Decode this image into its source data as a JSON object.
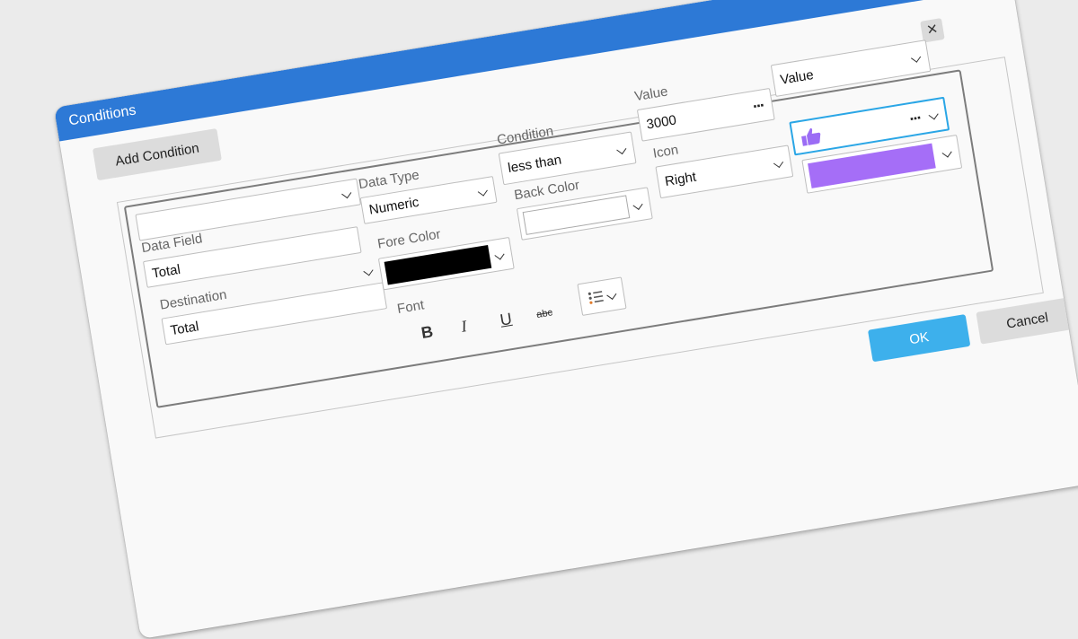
{
  "window": {
    "title": "Conditions"
  },
  "toolbar": {
    "add_condition_label": "Add Condition"
  },
  "condition": {
    "data_field": {
      "label": "Data Field",
      "value": "Total"
    },
    "destination": {
      "label": "Destination",
      "value": "Total"
    },
    "data_type": {
      "label": "Data Type",
      "value": "Numeric"
    },
    "fore_color": {
      "label": "Fore Color",
      "color": "#000000"
    },
    "font": {
      "label": "Font",
      "bold": "B",
      "italic": "I",
      "underline": "U",
      "strikethrough": "abc"
    },
    "condition_op": {
      "label": "Condition",
      "value": "less than"
    },
    "back_color": {
      "label": "Back Color",
      "color": "#ffffff"
    },
    "value": {
      "label": "Value",
      "value": "3000",
      "browse": "..."
    },
    "icon": {
      "label": "Icon",
      "value": "Right"
    },
    "value_type": {
      "value": "Value"
    },
    "icon_picker": {
      "icon": "thumbs-up-icon",
      "color": "#9b6cf5",
      "browse": "..."
    },
    "color_picker": {
      "color": "#a56ef7"
    },
    "list_style": {
      "icon": "list-format-icon"
    }
  },
  "footer": {
    "ok_label": "OK",
    "cancel_label": "Cancel"
  },
  "colors": {
    "titlebar": "#2d79d6",
    "ok_button": "#3db0ec",
    "accent_border": "#2aa6e6",
    "purple": "#a56ef7"
  }
}
